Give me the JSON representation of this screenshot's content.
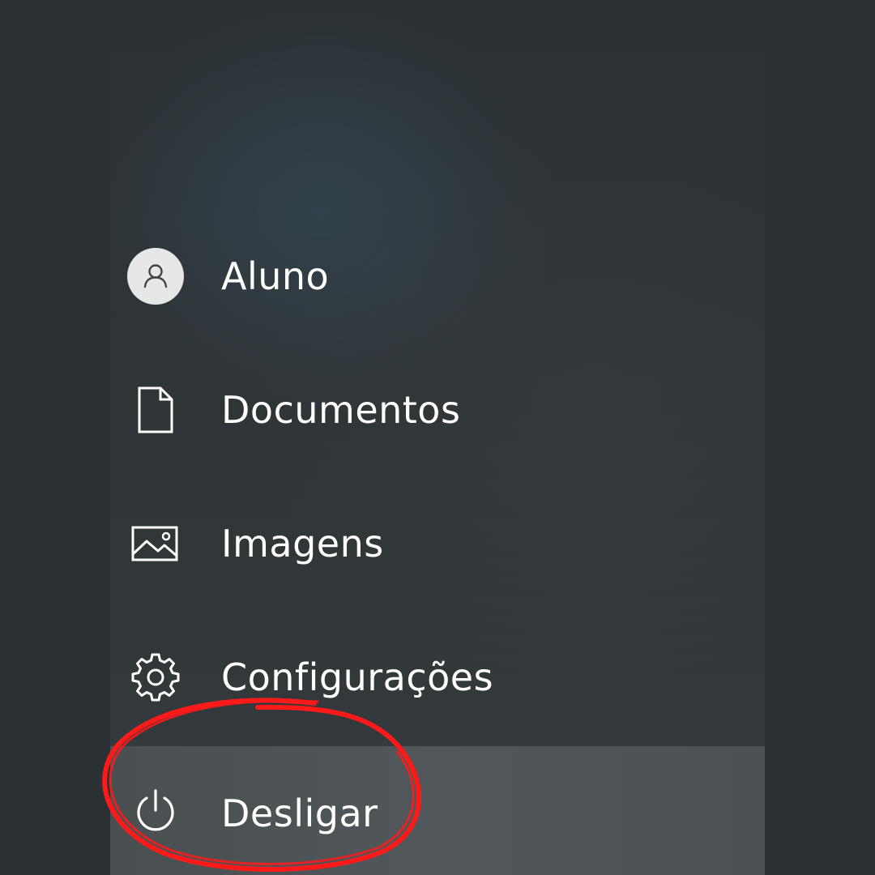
{
  "start_menu": {
    "items": [
      {
        "label": "Aluno",
        "icon": "user-icon"
      },
      {
        "label": "Documentos",
        "icon": "document-icon"
      },
      {
        "label": "Imagens",
        "icon": "image-icon"
      },
      {
        "label": "Configurações",
        "icon": "gear-icon"
      },
      {
        "label": "Desligar",
        "icon": "power-icon",
        "highlighted": true
      }
    ]
  },
  "colors": {
    "background": "#2a3034",
    "highlight": "#505659",
    "text": "#ffffff",
    "annotation": "#ff1a1a"
  }
}
